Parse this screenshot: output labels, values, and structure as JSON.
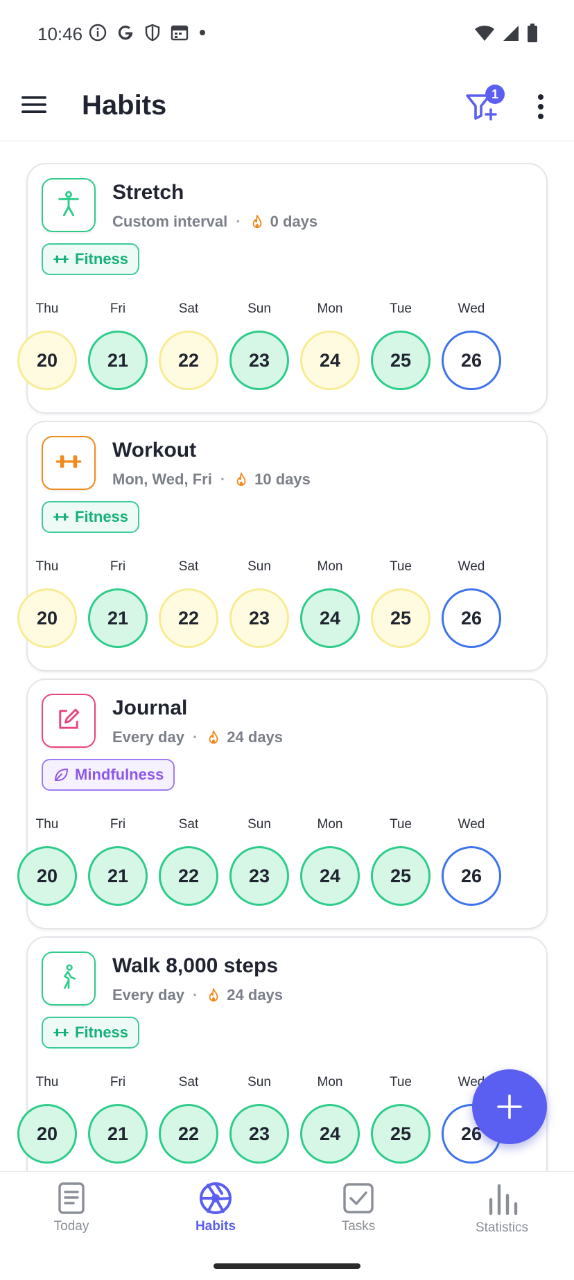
{
  "status_bar": {
    "time": "10:46",
    "icons_left": [
      "info-icon",
      "google-icon",
      "shield-icon",
      "calendar-icon",
      "dot-icon"
    ],
    "icons_right": [
      "wifi-icon",
      "signal-icon",
      "battery-icon"
    ]
  },
  "app_bar": {
    "title": "Habits",
    "filter_badge": "1",
    "accent": "#5b5ff2"
  },
  "habits": [
    {
      "name": "Stretch",
      "schedule": "Custom interval",
      "streak": "0 days",
      "icon": "person-stretch-icon",
      "icon_color": "#2ecc8a",
      "tag": {
        "label": "Fitness",
        "type": "fitness",
        "icon": "dumbbell-icon"
      },
      "days": [
        {
          "weekday": "Thu",
          "date": "20",
          "status": "skip"
        },
        {
          "weekday": "Fri",
          "date": "21",
          "status": "done"
        },
        {
          "weekday": "Sat",
          "date": "22",
          "status": "skip"
        },
        {
          "weekday": "Sun",
          "date": "23",
          "status": "done"
        },
        {
          "weekday": "Mon",
          "date": "24",
          "status": "skip"
        },
        {
          "weekday": "Tue",
          "date": "25",
          "status": "done"
        },
        {
          "weekday": "Wed",
          "date": "26",
          "status": "today"
        }
      ]
    },
    {
      "name": "Workout",
      "schedule": "Mon, Wed, Fri",
      "streak": "10 days",
      "icon": "dumbbell-icon",
      "icon_color": "#f08a1c",
      "tag": {
        "label": "Fitness",
        "type": "fitness",
        "icon": "dumbbell-icon"
      },
      "days": [
        {
          "weekday": "Thu",
          "date": "20",
          "status": "skip"
        },
        {
          "weekday": "Fri",
          "date": "21",
          "status": "done"
        },
        {
          "weekday": "Sat",
          "date": "22",
          "status": "skip"
        },
        {
          "weekday": "Sun",
          "date": "23",
          "status": "skip"
        },
        {
          "weekday": "Mon",
          "date": "24",
          "status": "done"
        },
        {
          "weekday": "Tue",
          "date": "25",
          "status": "skip"
        },
        {
          "weekday": "Wed",
          "date": "26",
          "status": "today"
        }
      ]
    },
    {
      "name": "Journal",
      "schedule": "Every day",
      "streak": "24 days",
      "icon": "edit-note-icon",
      "icon_color": "#e8457f",
      "tag": {
        "label": "Mindfulness",
        "type": "mindfulness",
        "icon": "leaf-icon"
      },
      "days": [
        {
          "weekday": "Thu",
          "date": "20",
          "status": "done"
        },
        {
          "weekday": "Fri",
          "date": "21",
          "status": "done"
        },
        {
          "weekday": "Sat",
          "date": "22",
          "status": "done"
        },
        {
          "weekday": "Sun",
          "date": "23",
          "status": "done"
        },
        {
          "weekday": "Mon",
          "date": "24",
          "status": "done"
        },
        {
          "weekday": "Tue",
          "date": "25",
          "status": "done"
        },
        {
          "weekday": "Wed",
          "date": "26",
          "status": "today"
        }
      ]
    },
    {
      "name": "Walk 8,000 steps",
      "schedule": "Every day",
      "streak": "24 days",
      "icon": "person-walking-icon",
      "icon_color": "#2ecc8a",
      "tag": {
        "label": "Fitness",
        "type": "fitness",
        "icon": "dumbbell-icon"
      },
      "days": [
        {
          "weekday": "Thu",
          "date": "20",
          "status": "done"
        },
        {
          "weekday": "Fri",
          "date": "21",
          "status": "done"
        },
        {
          "weekday": "Sat",
          "date": "22",
          "status": "done"
        },
        {
          "weekday": "Sun",
          "date": "23",
          "status": "done"
        },
        {
          "weekday": "Mon",
          "date": "24",
          "status": "done"
        },
        {
          "weekday": "Tue",
          "date": "25",
          "status": "done"
        },
        {
          "weekday": "Wed",
          "date": "26",
          "status": "today"
        }
      ]
    }
  ],
  "fab": {
    "icon": "plus-icon"
  },
  "bottom_nav": [
    {
      "label": "Today",
      "icon": "document-icon",
      "active": false
    },
    {
      "label": "Habits",
      "icon": "aperture-icon",
      "active": true
    },
    {
      "label": "Tasks",
      "icon": "checkbox-icon",
      "active": false
    },
    {
      "label": "Statistics",
      "icon": "bar-chart-icon",
      "active": false
    }
  ]
}
